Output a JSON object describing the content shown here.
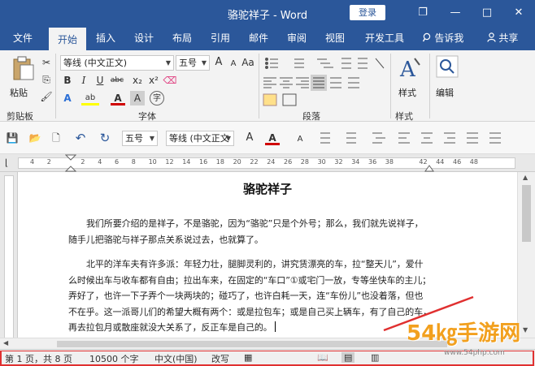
{
  "window": {
    "title": "骆驼祥子 - Word",
    "login": "登录",
    "restore_glyph": "❐",
    "minimize_glyph": "—",
    "maximize_glyph": "□",
    "close_glyph": "✕"
  },
  "tabs": [
    {
      "label": "文件"
    },
    {
      "label": "开始"
    },
    {
      "label": "插入"
    },
    {
      "label": "设计"
    },
    {
      "label": "布局"
    },
    {
      "label": "引用"
    },
    {
      "label": "邮件"
    },
    {
      "label": "审阅"
    },
    {
      "label": "视图"
    },
    {
      "label": "开发工具"
    }
  ],
  "tell_me": "告诉我",
  "share": "共享",
  "ribbon": {
    "clipboard": {
      "label": "剪贴板",
      "paste": "粘贴"
    },
    "font": {
      "label": "字体",
      "font_name": "等线 (中文正文)",
      "font_size": "五号",
      "grow": "A",
      "shrink": "A",
      "change_case": "Aa",
      "bold": "B",
      "italic": "I",
      "underline": "U",
      "strike": "abc",
      "subscript": "x₂",
      "superscript": "x²",
      "text_effect": "A",
      "highlight": "ab",
      "font_color": "A",
      "char_shade": "A",
      "enclose": "字"
    },
    "paragraph": {
      "label": "段落"
    },
    "styles": {
      "label": "样式",
      "styles_btn": "样式"
    },
    "editing": {
      "label": "",
      "editing_btn": "编辑"
    }
  },
  "qat": {
    "font_size": "五号",
    "font_name": "等线 (中文正文",
    "grow": "A",
    "shrink": "A",
    "font_color": "A"
  },
  "ruler": {
    "numbers": [
      "4",
      "2",
      "",
      "2",
      "4",
      "6",
      "8",
      "10",
      "12",
      "14",
      "16",
      "18",
      "20",
      "22",
      "24",
      "26",
      "28",
      "30",
      "32",
      "34",
      "36",
      "38",
      "",
      "42",
      "44",
      "46",
      "48"
    ]
  },
  "document": {
    "title": "骆驼祥子",
    "paragraphs": [
      [
        "我们所要介绍的是祥子，不是骆驼，因为“骆驼”只是个外号；那么，我们就先说祥子，",
        "随手儿把骆驼与祥子那点关系说过去，也就算了。"
      ],
      [
        "北平的洋车夫有许多派：年轻力壮，腿脚灵利的，讲究赁漂亮的车，拉“整天儿”，爱什",
        "么时候出车与收车都有自由；拉出车来，在固定的“车口”①或宅门一放，专等坐快车的主儿；",
        "弄好了，也许一下子弄个一块两块的；碰巧了，也许白耗一天，连“车份儿”也没着落，但也",
        "不在乎。这一派哥儿们的希望大概有两个：或是拉包车；或是自己买上辆车，有了自己的车，",
        "再去拉包月或散座就没大关系了，反正车是自己的。"
      ]
    ]
  },
  "status": {
    "page": "第 1 页，共 8 页",
    "words": "10500 个字",
    "lang": "中文(中国)",
    "track": "改写"
  },
  "watermark": {
    "text": "54㎏手游网",
    "sub": "www.54php.com"
  },
  "colors": {
    "brand": "#2b579a",
    "highlight": "#ffff00",
    "font_red": "#d00000",
    "annotation": "#e03030"
  }
}
